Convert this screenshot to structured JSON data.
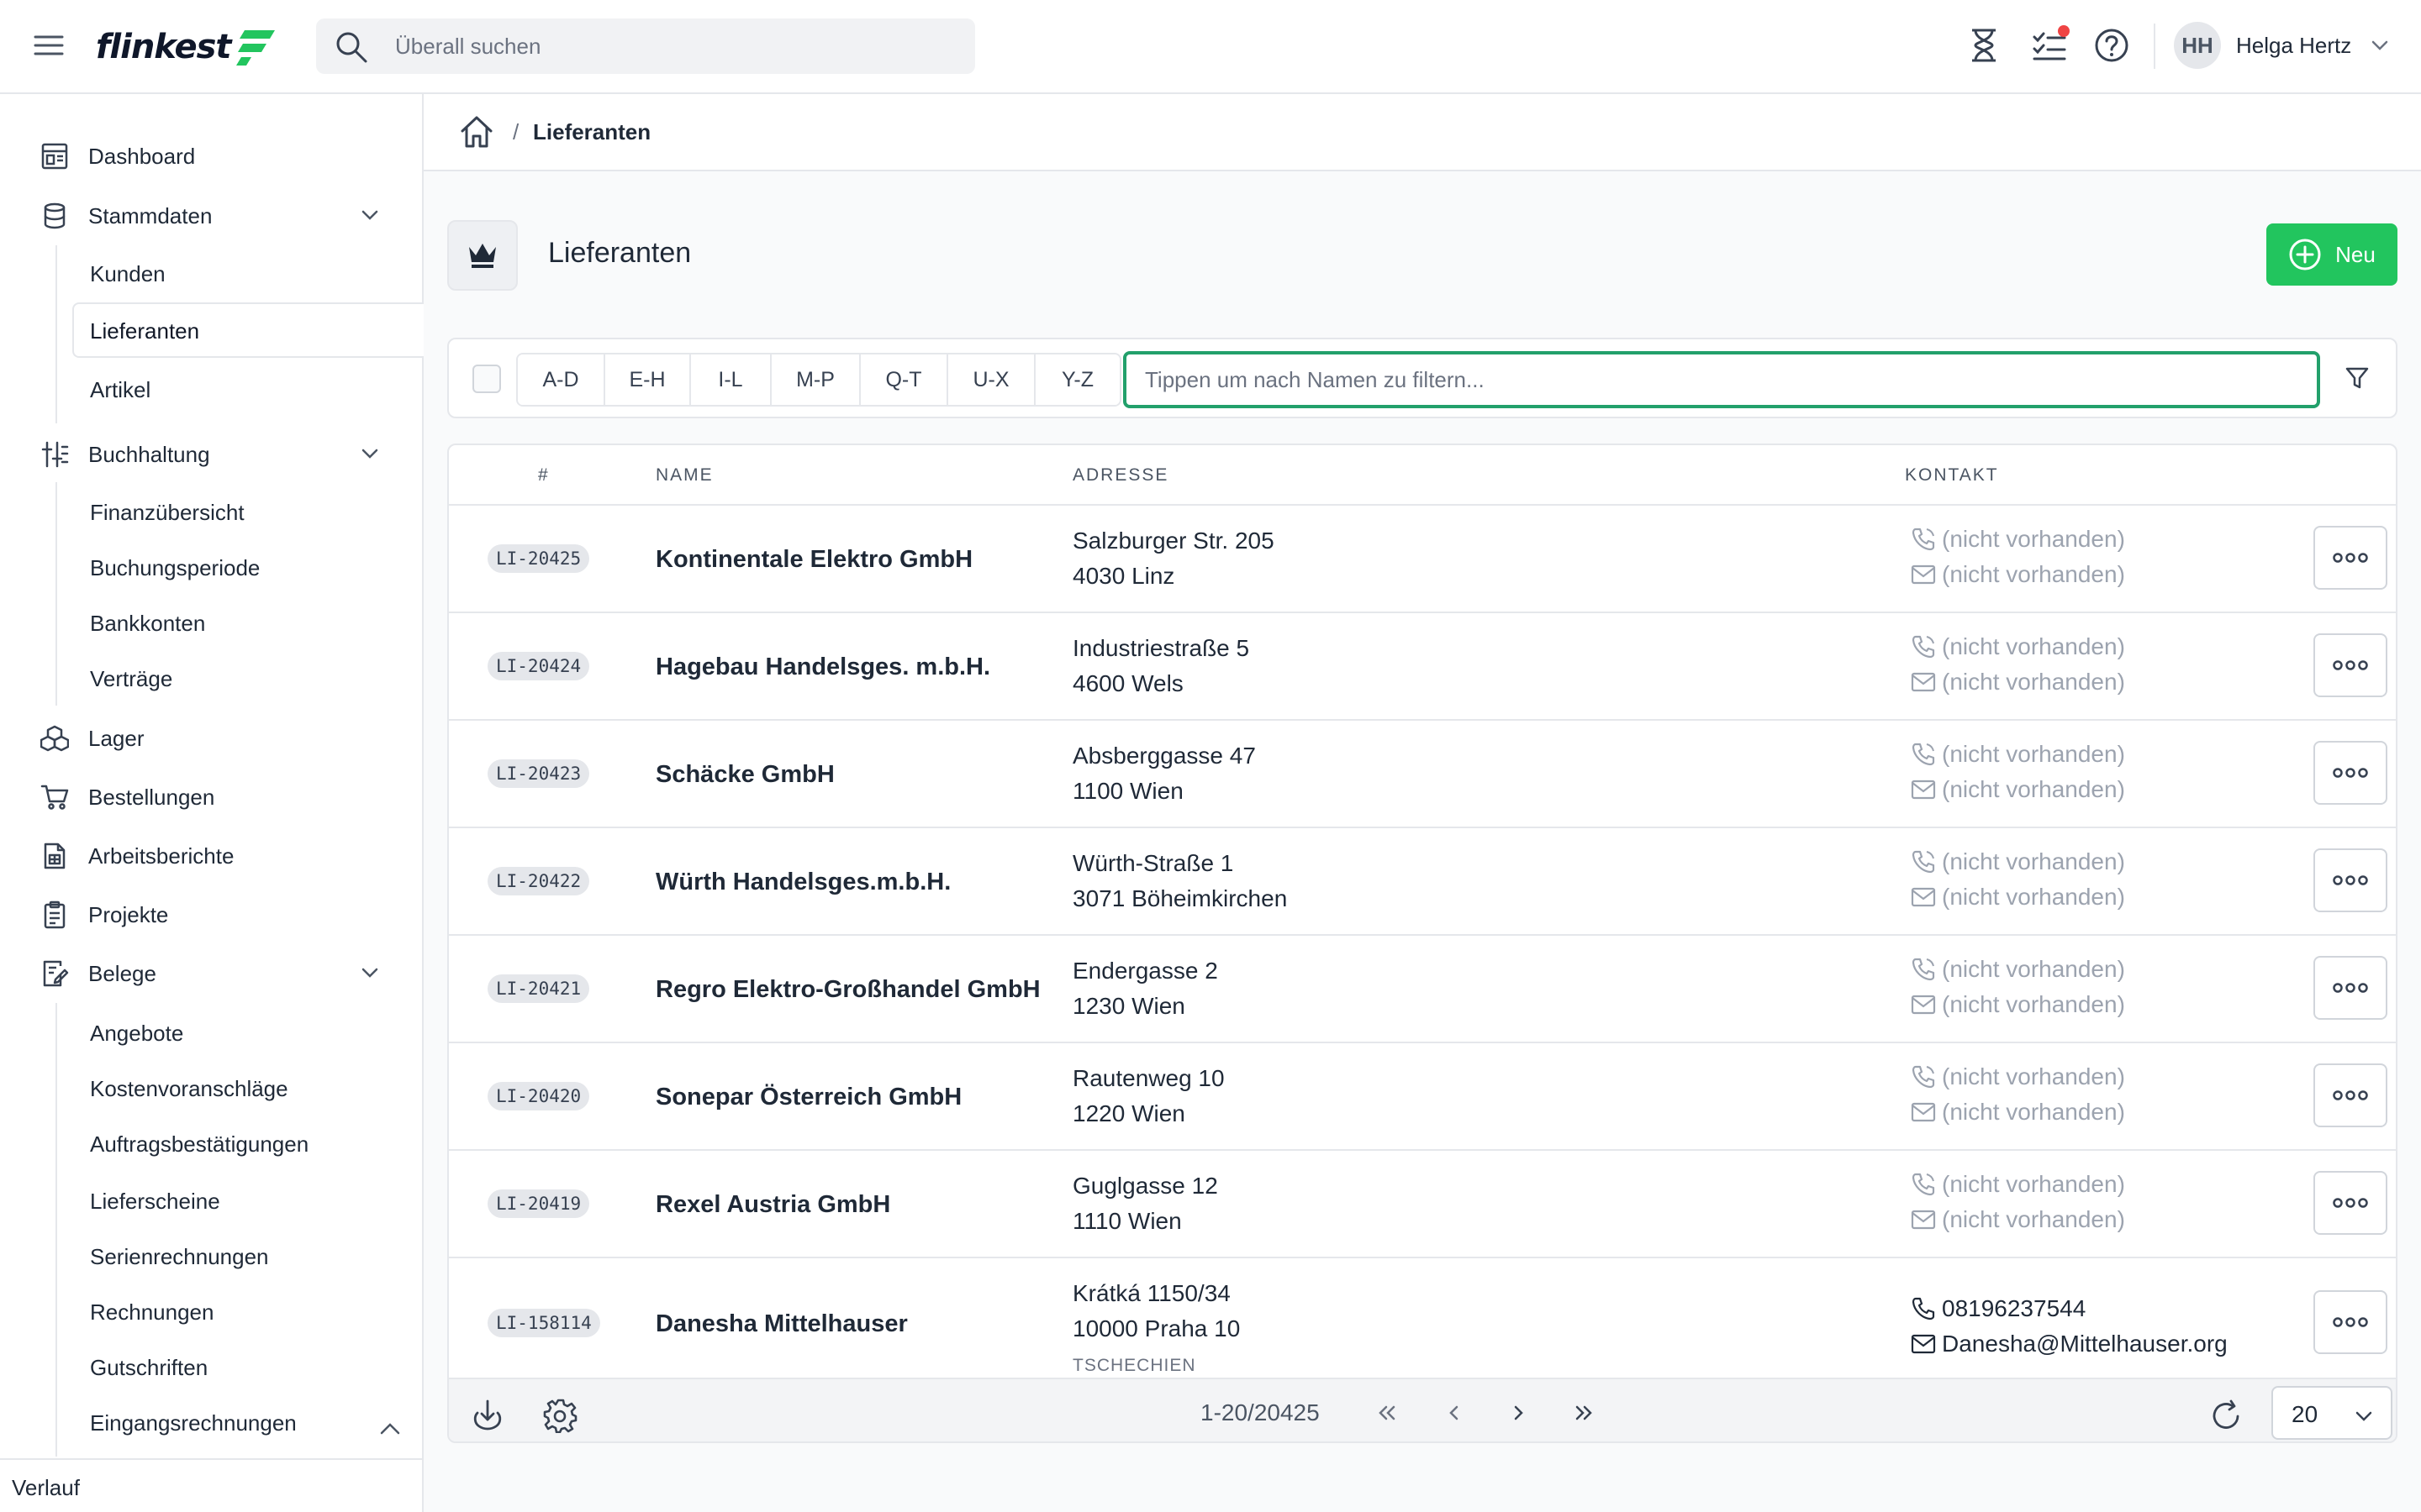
{
  "app": {
    "logo_text": "flinkest"
  },
  "search": {
    "placeholder": "Überall suchen"
  },
  "user": {
    "initials": "HH",
    "name": "Helga Hertz"
  },
  "sidebar": {
    "dashboard": "Dashboard",
    "stammdaten": {
      "label": "Stammdaten",
      "items": [
        "Kunden",
        "Lieferanten",
        "Artikel"
      ]
    },
    "buchhaltung": {
      "label": "Buchhaltung",
      "items": [
        "Finanzübersicht",
        "Buchungsperiode",
        "Bankkonten",
        "Verträge"
      ]
    },
    "lager": "Lager",
    "bestellungen": "Bestellungen",
    "arbeitsberichte": "Arbeitsberichte",
    "projekte": "Projekte",
    "belege": {
      "label": "Belege",
      "items": [
        "Angebote",
        "Kostenvoranschläge",
        "Auftragsbestätigungen",
        "Lieferscheine",
        "Serienrechnungen",
        "Rechnungen",
        "Gutschriften",
        "Eingangsrechnungen"
      ]
    },
    "footer": "Verlauf"
  },
  "breadcrumb": {
    "separator": "/",
    "current": "Lieferanten"
  },
  "page": {
    "title": "Lieferanten",
    "new_label": "Neu"
  },
  "filter": {
    "letters": [
      "A-D",
      "E-H",
      "I-L",
      "M-P",
      "Q-T",
      "U-X",
      "Y-Z"
    ],
    "placeholder": "Tippen um nach Namen zu filtern..."
  },
  "table": {
    "headers": {
      "id": "#",
      "name": "NAME",
      "address": "ADRESSE",
      "contact": "KONTAKT"
    },
    "rows": [
      {
        "id": "LI-20425",
        "name": "Kontinentale Elektro GmbH",
        "street": "Salzburger Str. 205",
        "city": "4030 Linz",
        "phone": "(nicht vorhanden)",
        "email": "(nicht vorhanden)"
      },
      {
        "id": "LI-20424",
        "name": "Hagebau Handelsges. m.b.H.",
        "street": "Industriestraße 5",
        "city": "4600 Wels",
        "phone": "(nicht vorhanden)",
        "email": "(nicht vorhanden)"
      },
      {
        "id": "LI-20423",
        "name": "Schäcke GmbH",
        "street": "Absberggasse 47",
        "city": "1100 Wien",
        "phone": "(nicht vorhanden)",
        "email": "(nicht vorhanden)"
      },
      {
        "id": "LI-20422",
        "name": "Würth Handelsges.m.b.H.",
        "street": "Würth-Straße 1",
        "city": "3071 Böheimkirchen",
        "phone": "(nicht vorhanden)",
        "email": "(nicht vorhanden)"
      },
      {
        "id": "LI-20421",
        "name": "Regro Elektro-Großhandel GmbH",
        "street": "Endergasse 2",
        "city": "1230 Wien",
        "phone": "(nicht vorhanden)",
        "email": "(nicht vorhanden)"
      },
      {
        "id": "LI-20420",
        "name": "Sonepar Österreich GmbH",
        "street": "Rautenweg 10",
        "city": "1220 Wien",
        "phone": "(nicht vorhanden)",
        "email": "(nicht vorhanden)"
      },
      {
        "id": "LI-20419",
        "name": "Rexel Austria GmbH",
        "street": "Guglgasse 12",
        "city": "1110 Wien",
        "phone": "(nicht vorhanden)",
        "email": "(nicht vorhanden)"
      },
      {
        "id": "LI-158114",
        "name": "Danesha Mittelhauser",
        "street": "Krátká 1150/34",
        "city": "10000 Praha 10",
        "country": "TSCHECHIEN",
        "phone": "08196237544",
        "email": "Danesha@Mittelhauser.org"
      }
    ]
  },
  "footer": {
    "range": "1-20/20425",
    "page_size": "20"
  },
  "colors": {
    "accent": "#22c55e",
    "focus": "#22a06b",
    "notification": "#ef4444"
  }
}
